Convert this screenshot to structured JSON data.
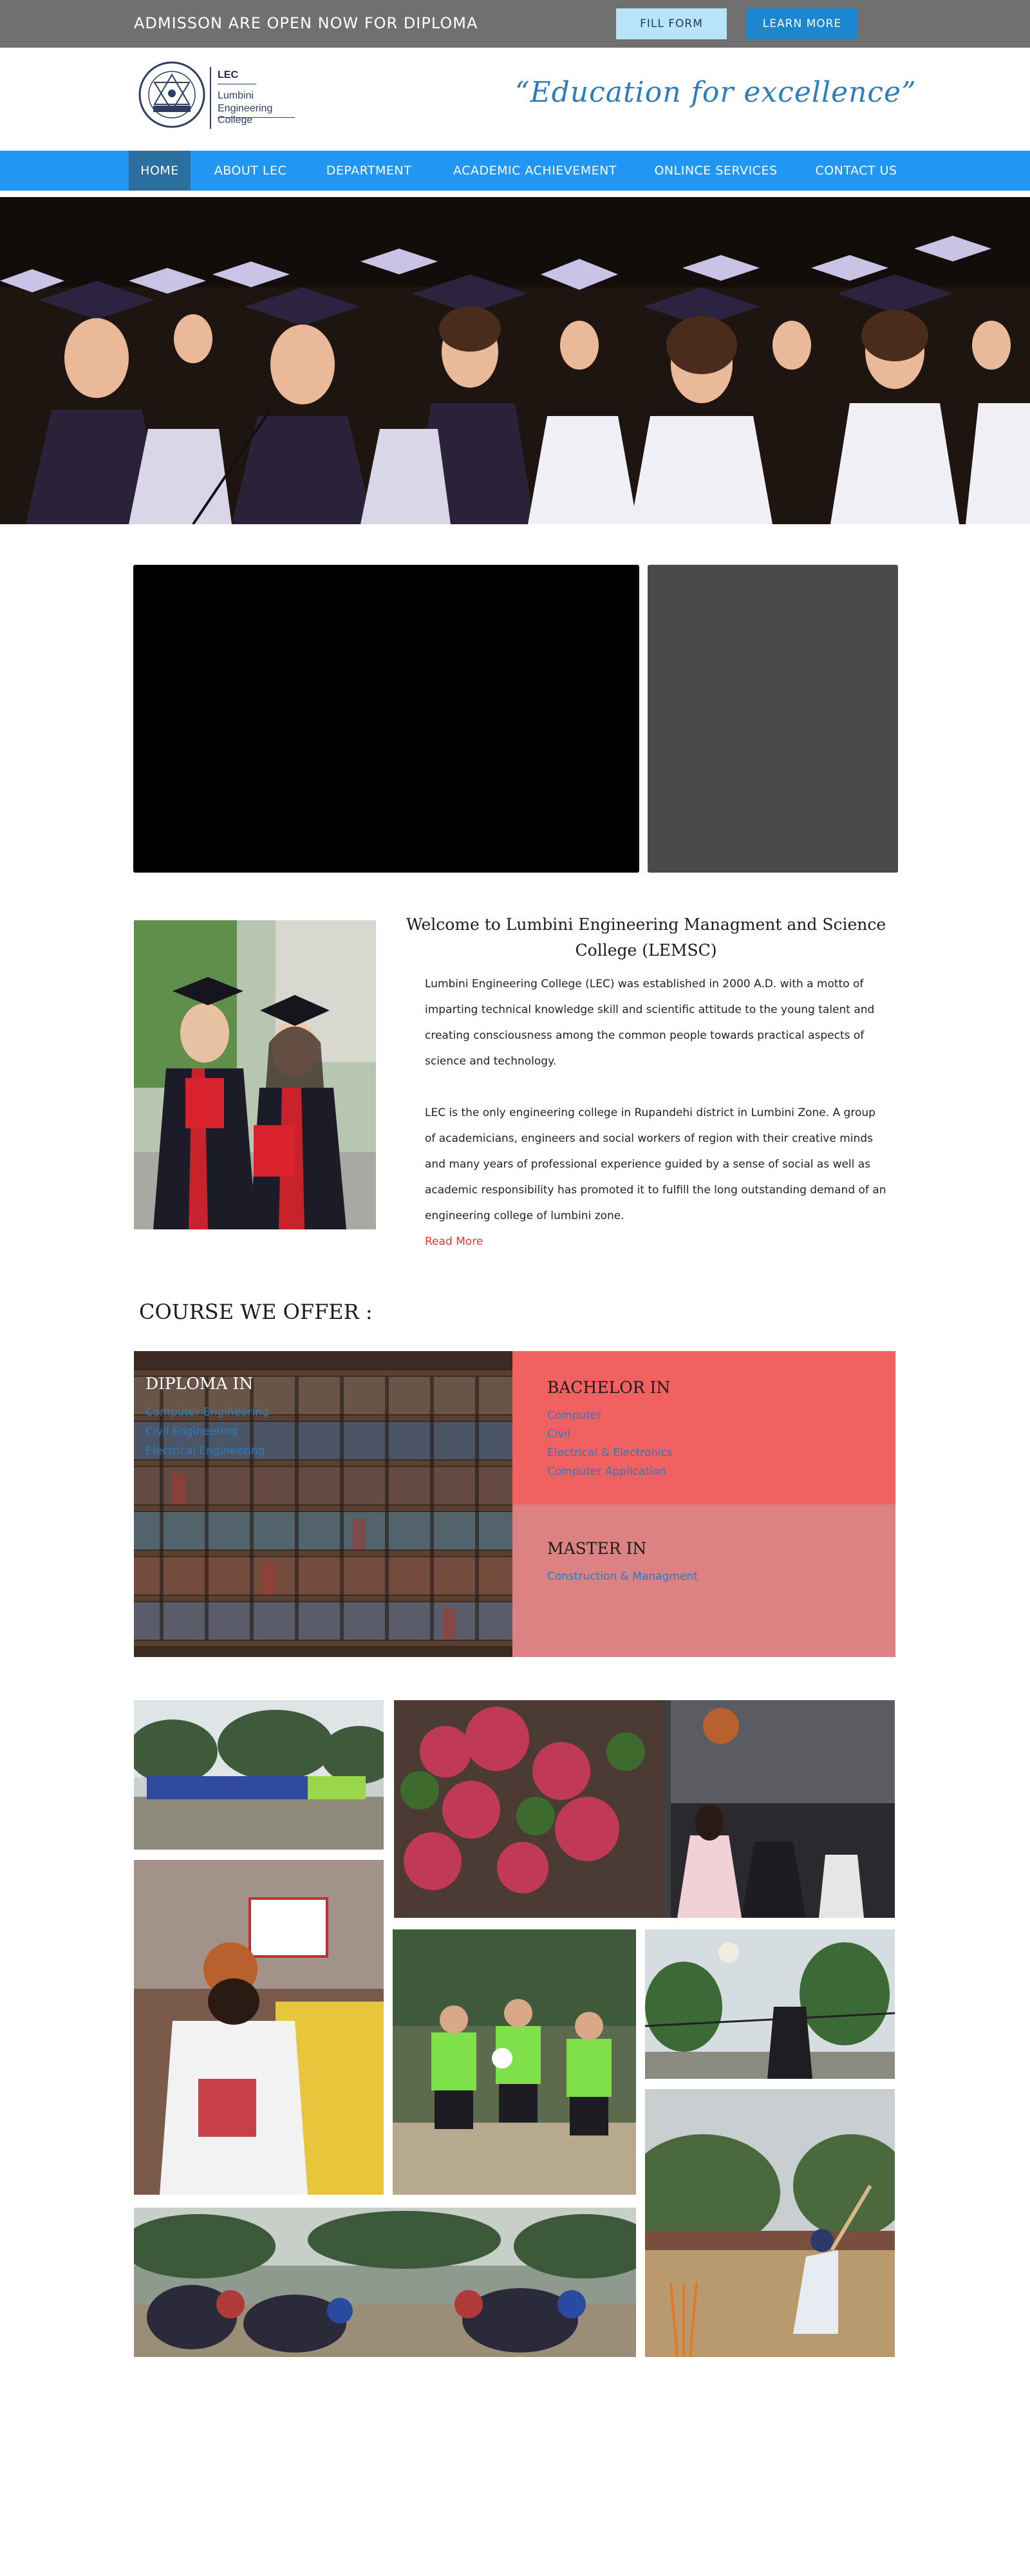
{
  "topbar": {
    "announcement": "ADMISSON ARE OPEN NOW FOR DIPLOMA",
    "fill_form": "FILL FORM",
    "learn_more": "LEARN MORE"
  },
  "header": {
    "logo_abbr": "LEC",
    "logo_name_line1": "Lumbini",
    "logo_name_line2": "Engineering College",
    "tagline": "“Education for excellence”"
  },
  "nav": {
    "items": [
      {
        "label": "HOME",
        "active": true
      },
      {
        "label": "ABOUT LEC"
      },
      {
        "label": "DEPARTMENT"
      },
      {
        "label": "ACADEMIC ACHIEVEMENT"
      },
      {
        "label": "ONLINCE SERVICES"
      },
      {
        "label": "CONTACT US"
      }
    ]
  },
  "welcome": {
    "title": "Welcome to Lumbini Engineering Managment and Science College (LEMSC)",
    "paragraph1": "Lumbini Engineering College (LEC) was established in 2000 A.D. with a motto of imparting technical knowledge skill and scientific attitude to the young talent and creating consciousness among the common people towards practical aspects of science and technology.",
    "paragraph2": "LEC is the only engineering college in Rupandehi district in Lumbini Zone. A group of academicians, engineers and social workers of region with their creative minds and many years of professional experience guided by a sense of social as well as academic responsibility has promoted it to fulfill the long outstanding demand of an engineering college of lumbini zone.",
    "read_more": "Read More"
  },
  "courses": {
    "heading": "COURSE WE OFFER :",
    "diploma": {
      "title": "DIPLOMA IN",
      "items": [
        "Computer Engineering",
        "Civil Engineering",
        "Electrical Engineering"
      ]
    },
    "bachelor": {
      "title": "BACHELOR IN",
      "items": [
        "Computer",
        "Civil",
        "Electrical & Electronics",
        "Computer Application"
      ]
    },
    "master": {
      "title": "MASTER IN",
      "items": [
        "Construction & Managment"
      ]
    }
  },
  "colors": {
    "nav_blue": "#2196f3",
    "bachelor_red": "#f26161",
    "master_pink": "#dc8282",
    "link_blue": "#2a7bbd",
    "read_more_red": "#e53935"
  }
}
